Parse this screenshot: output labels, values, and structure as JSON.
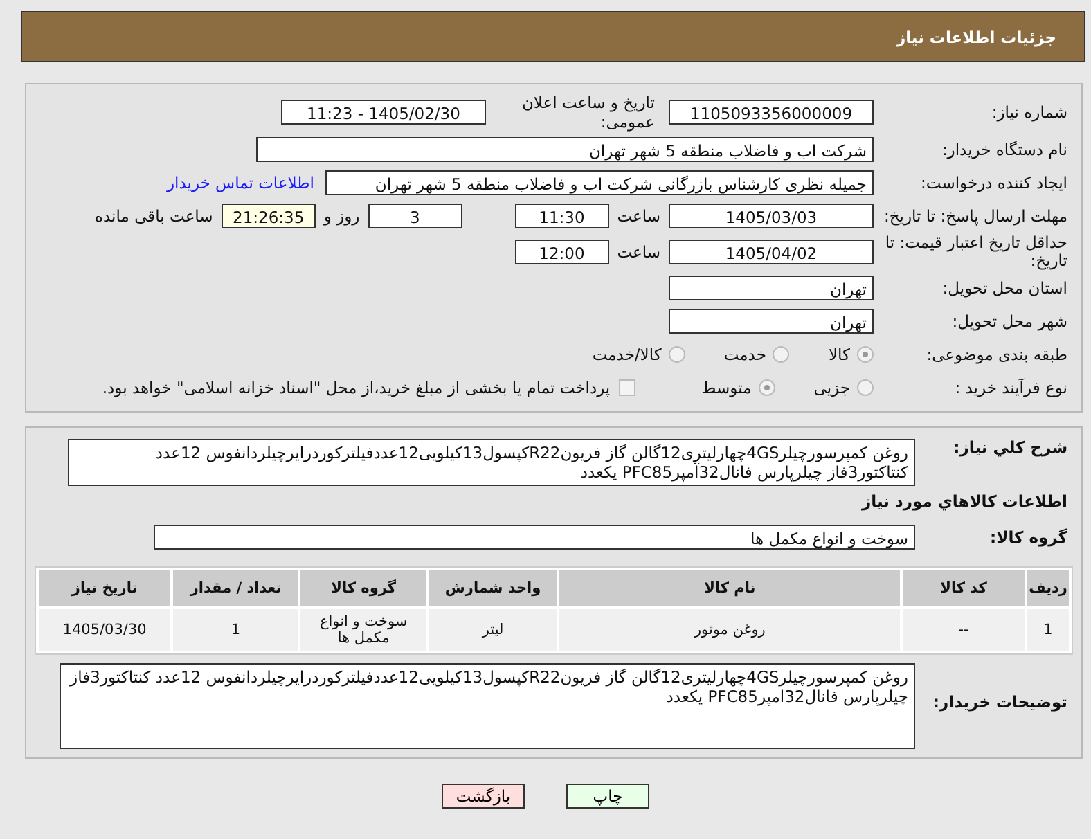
{
  "header": {
    "title": "جزئیات اطلاعات نیاز"
  },
  "need_number": {
    "label": "شماره نیاز:",
    "value": "1105093356000009"
  },
  "announce": {
    "label": "تاریخ و ساعت اعلان عمومی:",
    "value": "1405/02/30 - 11:23"
  },
  "buyer": {
    "label": "نام دستگاه خریدار:",
    "value": "شرکت اب و فاضلاب منطقه 5 شهر تهران"
  },
  "creator": {
    "label": "ایجاد کننده درخواست:",
    "value": "جمیله نظری کارشناس بازرگانی شرکت اب و فاضلاب منطقه 5 شهر تهران",
    "link": "اطلاعات تماس خریدار"
  },
  "deadline": {
    "label": "مهلت ارسال پاسخ: تا تاریخ:",
    "date": "1405/03/03",
    "time_label": "ساعت",
    "time": "11:30",
    "days": "3",
    "days_label": "روز و",
    "remaining": "21:26:35",
    "remaining_label": "ساعت باقی مانده"
  },
  "validity": {
    "label": "حداقل تاریخ اعتبار قیمت: تا تاریخ:",
    "date": "1405/04/02",
    "time_label": "ساعت",
    "time": "12:00"
  },
  "province": {
    "label": "استان محل تحویل:",
    "value": "تهران"
  },
  "city": {
    "label": "شهر محل تحویل:",
    "value": "تهران"
  },
  "category": {
    "label": "طبقه بندی موضوعی:",
    "options": [
      {
        "label": "کالا",
        "selected": true
      },
      {
        "label": "خدمت",
        "selected": false
      },
      {
        "label": "کالا/خدمت",
        "selected": false
      }
    ]
  },
  "process": {
    "label": "نوع فرآیند خرید :",
    "options": [
      {
        "label": "جزیی",
        "selected": false
      },
      {
        "label": "متوسط",
        "selected": true
      }
    ],
    "payment": {
      "checked": false,
      "text": "پرداخت تمام یا بخشی از مبلغ خرید،از محل \"اسناد خزانه اسلامی\" خواهد بود."
    }
  },
  "summary": {
    "label": "شرح کلي نياز:",
    "value": "روغن کمپرسورچیلر4GSچهارلیتری12گالن گاز فریونR22کپسول13کیلویی12عددفیلترکوردرایرچیلردانفوس 12عدد کنتاکتور3فاز چیلرپارس فانال32آمپرPFC85 یکعدد"
  },
  "goods_title": "اطلاعات کالاهاي مورد نياز",
  "goods_group": {
    "label": "گروه کالا:",
    "value": "سوخت و انواع مکمل ها"
  },
  "table": {
    "columns": [
      "ردیف",
      "کد کالا",
      "نام کالا",
      "واحد شمارش",
      "گروه کالا",
      "تعداد / مقدار",
      "تاریخ نیاز"
    ],
    "rows": [
      [
        "1",
        "--",
        "روغن موتور",
        "لیتر",
        "سوخت و انواع مکمل ها",
        "1",
        "1405/03/30"
      ]
    ]
  },
  "buyer_notes": {
    "label": "توضیحات خریدار:",
    "value": "روغن کمپرسورچیلر4GSچهارلیتری12گالن گاز فریونR22کپسول13کیلویی12عددفیلترکوردرایرچیلردانفوس 12عدد کنتاکتور3فاز چیلرپارس فانال32امپرPFC85 یکعدد"
  },
  "buttons": [
    {
      "kind": "print",
      "label": "چاپ"
    },
    {
      "kind": "back",
      "label": "بازگشت"
    }
  ]
}
